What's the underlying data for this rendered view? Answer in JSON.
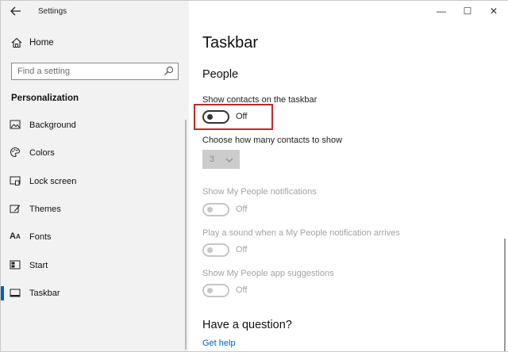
{
  "window": {
    "app_title": "Settings",
    "controls": {
      "minimize": "—",
      "maximize": "☐",
      "close": "✕"
    }
  },
  "sidebar": {
    "home_label": "Home",
    "search": {
      "placeholder": "Find a setting",
      "value": ""
    },
    "section_title": "Personalization",
    "items": [
      {
        "label": "Background",
        "icon": "image-icon"
      },
      {
        "label": "Colors",
        "icon": "palette-icon"
      },
      {
        "label": "Lock screen",
        "icon": "lock-screen-icon"
      },
      {
        "label": "Themes",
        "icon": "themes-icon"
      },
      {
        "label": "Fonts",
        "icon": "font-icon"
      },
      {
        "label": "Start",
        "icon": "start-icon"
      },
      {
        "label": "Taskbar",
        "icon": "taskbar-icon",
        "active": true
      }
    ]
  },
  "main": {
    "page_title": "Taskbar",
    "people_heading": "People",
    "show_contacts": {
      "label": "Show contacts on the taskbar",
      "state": "Off"
    },
    "contacts_count": {
      "label": "Choose how many contacts to show",
      "value": "3"
    },
    "notifications": {
      "label": "Show My People notifications",
      "state": "Off"
    },
    "sound": {
      "label": "Play a sound when a My People notification arrives",
      "state": "Off"
    },
    "suggestions": {
      "label": "Show My People app suggestions",
      "state": "Off"
    },
    "question_heading": "Have a question?",
    "help_link": "Get help"
  },
  "colors": {
    "accent": "#0063b1",
    "highlight": "#c0272d",
    "sidebar_bg": "#f2f2f2"
  }
}
